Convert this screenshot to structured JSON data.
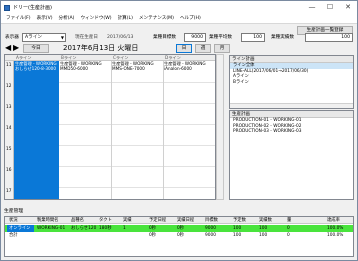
{
  "window": {
    "title": "ドリー(生産計画)",
    "minimize": "—",
    "maximize": "☐",
    "close": "✕"
  },
  "menu": [
    "ファイル(F)",
    "表示(V)",
    "分析(A)",
    "ウィンドウ(W)",
    "計算(L)",
    "メンテナンス(M)",
    "ヘルプ(H)"
  ],
  "toolbar": {
    "plan_list_button": "生産計画一覧登録",
    "display_label": "表示器",
    "display_value": "Aライン",
    "current_date_label": "現在生産日",
    "current_date_value": "2017/06/13",
    "target_qty_label": "業種目標数",
    "target_qty_value": "9000",
    "unit_target_label": "業種平均数",
    "unit_target_value": "100",
    "achieved_label": "業種実績数",
    "achieved_value": "100"
  },
  "nav": {
    "prev_arrow": "◀",
    "next_arrow": "▶",
    "today_button": "今日",
    "date_display": "2017年6月13日 火曜日",
    "view_day": "日",
    "view_week": "週",
    "view_month": "月"
  },
  "grid": {
    "columns": [
      "Aライン",
      "Bライン",
      "Cライン",
      "Dライン"
    ],
    "time_labels": [
      "11",
      "12",
      "13",
      "14",
      "15",
      "16",
      "17"
    ],
    "entries": [
      {
        "line1": "生産管理 - WORKING",
        "line2": "おしらせ120-8-3000"
      },
      {
        "line1": "生産管理 - WORKING",
        "line2": "MMD50-6000"
      },
      {
        "line1": "生産管理 - WORKING",
        "line2": "MMS-ONE-7000"
      },
      {
        "line1": "生産管理 - WORKING",
        "line2": "iAnalon-6000"
      }
    ]
  },
  "line_plan_panel": {
    "title": "ライン計画",
    "selected": "ライン全体",
    "lines": [
      "LINE-ALL(2017/06/01→2017/06/30)",
      "Aライン",
      "Bライン"
    ]
  },
  "production_plan_panel": {
    "title": "生産計画",
    "lines": [
      "PRODUCTION-01 - WORKING-01",
      "PRODUCTION-02 - WORKING-02",
      "PRODUCTION-03 - WORKING-03"
    ]
  },
  "production_mgmt": {
    "title": "生産管理",
    "headers": [
      "状況",
      "製業時間名",
      "品種名",
      "タクト",
      "実績",
      "予定日程",
      "実績日程",
      "目標数",
      "予定数",
      "実績数",
      "量",
      "達成率"
    ],
    "rows": [
      [
        "オンライン",
        "WORKING-01",
        "おしらせ120",
        "180秒",
        "1",
        "0秒",
        "0秒",
        "9000",
        "100",
        "100",
        "0",
        "100.0%"
      ],
      [
        "合計",
        "",
        "",
        "",
        "",
        "0秒",
        "0秒",
        "9000",
        "100",
        "100",
        "0",
        "100.0%"
      ]
    ]
  },
  "colors": {
    "selection_blue": "#0a78d7",
    "status_green": "#49e43c"
  }
}
